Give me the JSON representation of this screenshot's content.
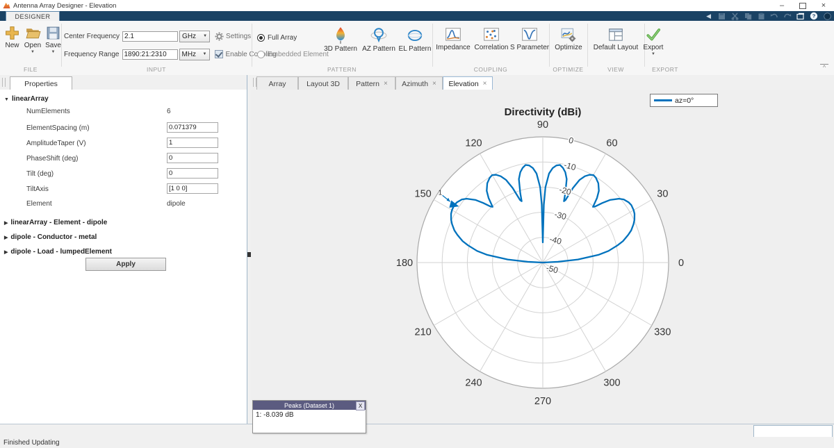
{
  "window": {
    "title": "Antenna Array Designer - Elevation"
  },
  "ribbon": {
    "tab_label": "DESIGNER"
  },
  "ui": {
    "close_glyph": "×",
    "dropdown_glyph": "▼",
    "collapsed_glyph": "▶",
    "expanded_glyph": "▼",
    "minimize_glyph": "–",
    "ribbon_collapse_glyph": "^",
    "qa_chevron_glyph": "◀",
    "help_glyph": "?"
  },
  "toolbar": {
    "file": {
      "section": "FILE",
      "new_label": "New",
      "open_label": "Open",
      "save_label": "Save"
    },
    "input": {
      "section": "INPUT",
      "center_frequency_label": "Center Frequency",
      "center_frequency_value": "2.1",
      "center_frequency_unit": "GHz",
      "settings_label": "Settings",
      "frequency_range_label": "Frequency Range",
      "frequency_range_value": "1890:21:2310",
      "frequency_range_unit": "MHz",
      "enable_coupling_label": "Enable Coupling"
    },
    "pattern": {
      "section": "PATTERN",
      "full_array_label": "Full Array",
      "embedded_element_label": "Embedded Element",
      "pattern3d_label": "3D Pattern",
      "az_label": "AZ Pattern",
      "el_label": "EL Pattern"
    },
    "coupling": {
      "section": "COUPLING",
      "impedance_label": "Impedance",
      "correlation_label": "Correlation",
      "sparameter_label": "S Parameter"
    },
    "optimize": {
      "section": "OPTIMIZE",
      "optimize_label": "Optimize"
    },
    "view": {
      "section": "VIEW",
      "default_layout_label": "Default Layout"
    },
    "export": {
      "section": "EXPORT",
      "export_label": "Export"
    }
  },
  "properties": {
    "tab_label": "Properties",
    "root_label": "linearArray",
    "rows": [
      {
        "label": "NumElements",
        "value": "6",
        "editable": false
      },
      {
        "label": "ElementSpacing (m)",
        "value": "0.071379",
        "editable": true
      },
      {
        "label": "AmplitudeTaper (V)",
        "value": "1",
        "editable": true
      },
      {
        "label": "PhaseShift (deg)",
        "value": "0",
        "editable": true
      },
      {
        "label": "Tilt (deg)",
        "value": "0",
        "editable": true
      },
      {
        "label": "TiltAxis",
        "value": "[1 0 0]",
        "editable": true
      },
      {
        "label": "Element",
        "value": "dipole",
        "editable": false
      }
    ],
    "groups": [
      "linearArray - Element - dipole",
      "dipole - Conductor - metal",
      "dipole - Load - lumpedElement"
    ],
    "apply_label": "Apply"
  },
  "doc_tabs": [
    {
      "label": "Array",
      "closable": false,
      "active": false
    },
    {
      "label": "Layout 3D",
      "closable": false,
      "active": false
    },
    {
      "label": "Pattern",
      "closable": true,
      "active": false
    },
    {
      "label": "Azimuth",
      "closable": true,
      "active": false
    },
    {
      "label": "Elevation",
      "closable": true,
      "active": true
    }
  ],
  "chart_data": {
    "type": "polar-line",
    "title": "Directivity (dBi)",
    "rlim": [
      -50,
      0
    ],
    "radial_ticks_db": [
      0,
      -10,
      -20,
      -30,
      -40,
      -50
    ],
    "angular_ticks_deg": [
      0,
      30,
      60,
      90,
      120,
      150,
      180,
      210,
      240,
      270,
      300,
      330
    ],
    "radial_label_angle_deg": 79,
    "grid": true,
    "legend_position": "top-right",
    "series": [
      {
        "name": "az=0°",
        "color": "#0072bd",
        "points_deg_db": [
          [
            0,
            -50
          ],
          [
            3,
            -44
          ],
          [
            5,
            -36
          ],
          [
            8,
            -27.5
          ],
          [
            10,
            -23.5
          ],
          [
            13,
            -19.5
          ],
          [
            15,
            -17
          ],
          [
            18,
            -14.3
          ],
          [
            20,
            -12.6
          ],
          [
            23,
            -10.8
          ],
          [
            25,
            -9.8
          ],
          [
            28,
            -8.7
          ],
          [
            30,
            -8.3
          ],
          [
            33,
            -8.04
          ],
          [
            35,
            -8.3
          ],
          [
            38,
            -9.2
          ],
          [
            40,
            -10.5
          ],
          [
            43,
            -13.5
          ],
          [
            45,
            -16.5
          ],
          [
            47,
            -19.5
          ],
          [
            48,
            -20.2
          ],
          [
            50,
            -16.5
          ],
          [
            52,
            -13.8
          ],
          [
            55,
            -11.5
          ],
          [
            58,
            -10.2
          ],
          [
            60,
            -9.8
          ],
          [
            62,
            -10.5
          ],
          [
            64,
            -11.8
          ],
          [
            66,
            -14
          ],
          [
            68,
            -18
          ],
          [
            70,
            -23.5
          ],
          [
            71,
            -24.2
          ],
          [
            72,
            -21
          ],
          [
            74,
            -15.5
          ],
          [
            76,
            -13
          ],
          [
            78,
            -11.5
          ],
          [
            80,
            -10.6
          ],
          [
            82,
            -11
          ],
          [
            84,
            -12.2
          ],
          [
            86,
            -14.5
          ],
          [
            88,
            -20
          ],
          [
            89,
            -27
          ],
          [
            90,
            -42
          ],
          [
            91,
            -27
          ],
          [
            92,
            -20
          ],
          [
            94,
            -14.5
          ],
          [
            96,
            -12.2
          ],
          [
            98,
            -11
          ],
          [
            100,
            -10.6
          ],
          [
            102,
            -11.5
          ],
          [
            104,
            -13
          ],
          [
            106,
            -15.5
          ],
          [
            108,
            -21
          ],
          [
            109,
            -24.2
          ],
          [
            110,
            -23.5
          ],
          [
            112,
            -18
          ],
          [
            114,
            -14
          ],
          [
            116,
            -11.8
          ],
          [
            118,
            -10.5
          ],
          [
            120,
            -9.8
          ],
          [
            122,
            -10.2
          ],
          [
            125,
            -11.5
          ],
          [
            128,
            -13.8
          ],
          [
            130,
            -16.5
          ],
          [
            132,
            -20.2
          ],
          [
            133,
            -19.5
          ],
          [
            135,
            -16.5
          ],
          [
            137,
            -13.5
          ],
          [
            140,
            -10.5
          ],
          [
            142,
            -9.2
          ],
          [
            145,
            -8.3
          ],
          [
            147,
            -8.04
          ],
          [
            150,
            -8.3
          ],
          [
            152,
            -8.7
          ],
          [
            155,
            -9.8
          ],
          [
            157,
            -10.8
          ],
          [
            160,
            -12.6
          ],
          [
            162,
            -14.3
          ],
          [
            165,
            -17
          ],
          [
            167,
            -19.5
          ],
          [
            170,
            -23.5
          ],
          [
            172,
            -27.5
          ],
          [
            175,
            -36
          ],
          [
            177,
            -44
          ],
          [
            180,
            -50
          ]
        ]
      }
    ],
    "peaks": [
      {
        "id": "1",
        "angle_deg": 147,
        "value_db": -8.039
      }
    ]
  },
  "peaks_panel": {
    "title": "Peaks (Dataset 1)",
    "close_label": "X",
    "entries": [
      "1: -8.039 dB"
    ]
  },
  "status": {
    "text": "Finished Updating"
  },
  "colors": {
    "accent": "#0072bd",
    "ribbon": "#1a4264",
    "peaks_header": "#5b5b80",
    "figure_bg": "#efefef"
  }
}
